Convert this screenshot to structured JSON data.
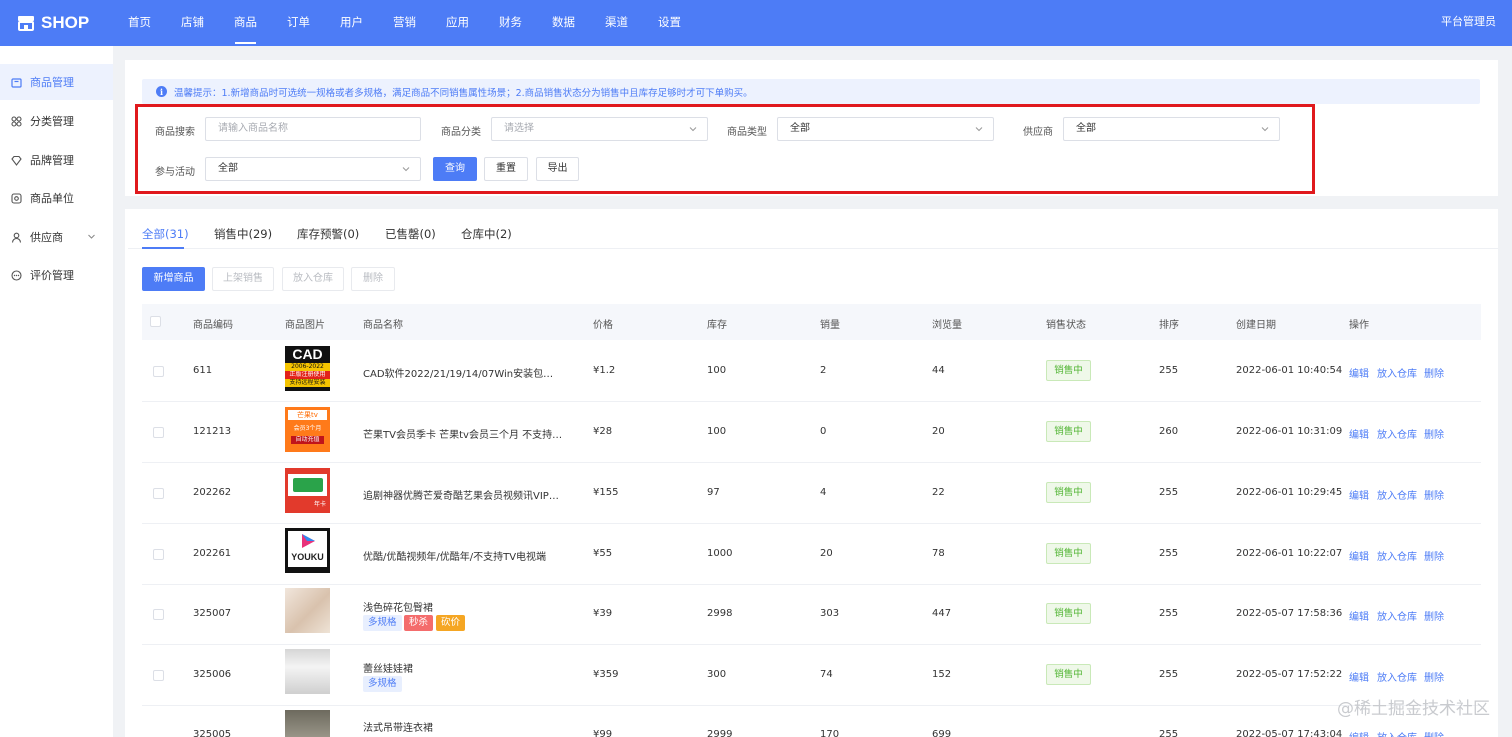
{
  "app": {
    "logo_text": "SHOP",
    "admin_label": "平台管理员"
  },
  "nav": [
    {
      "label": "首页"
    },
    {
      "label": "店铺"
    },
    {
      "label": "商品"
    },
    {
      "label": "订单"
    },
    {
      "label": "用户"
    },
    {
      "label": "营销"
    },
    {
      "label": "应用"
    },
    {
      "label": "财务"
    },
    {
      "label": "数据"
    },
    {
      "label": "渠道"
    },
    {
      "label": "设置"
    }
  ],
  "sidebar": [
    {
      "label": "商品管理",
      "icon": "bag-icon"
    },
    {
      "label": "分类管理",
      "icon": "grid-icon"
    },
    {
      "label": "品牌管理",
      "icon": "diamond-icon"
    },
    {
      "label": "商品单位",
      "icon": "unit-icon"
    },
    {
      "label": "供应商",
      "icon": "user-icon"
    },
    {
      "label": "评价管理",
      "icon": "comment-icon"
    }
  ],
  "tip": "温馨提示：1.新增商品时可选统一规格或者多规格，满足商品不同销售属性场景；2.商品销售状态分为销售中且库存足够时才可下单购买。",
  "filters": {
    "search_label": "商品搜索",
    "search_placeholder": "请输入商品名称",
    "category_label": "商品分类",
    "category_placeholder": "请选择",
    "type_label": "商品类型",
    "type_value": "全部",
    "supplier_label": "供应商",
    "supplier_value": "全部",
    "activity_label": "参与活动",
    "activity_value": "全部",
    "query_btn": "查询",
    "reset_btn": "重置",
    "export_btn": "导出"
  },
  "tabs": [
    "全部(31)",
    "销售中(29)",
    "库存预警(0)",
    "已售罄(0)",
    "仓库中(2)"
  ],
  "actions": {
    "add": "新增商品",
    "on_sale": "上架销售",
    "to_warehouse": "放入仓库",
    "delete": "删除"
  },
  "columns": [
    "商品编码",
    "商品图片",
    "商品名称",
    "价格",
    "库存",
    "销量",
    "浏览量",
    "销售状态",
    "排序",
    "创建日期",
    "操作"
  ],
  "row_ops": [
    "编辑",
    "放入仓库",
    "删除"
  ],
  "rows": [
    {
      "code": "611",
      "name": "CAD软件2022/21/19/14/07Win安装包下载制...",
      "price": "¥1.2",
      "stock": "100",
      "sales": "2",
      "views": "44",
      "status": "销售中",
      "sort": "255",
      "date": "2022-06-01 10:40:54",
      "thumb": "CAD",
      "thumb_lines": [
        "2006-2022",
        "正版注册使用",
        "支持远程安装"
      ]
    },
    {
      "code": "121213",
      "name": "芒果TV会员季卡 芒果tv会员三个月 不支持电...",
      "price": "¥28",
      "stock": "100",
      "sales": "0",
      "views": "20",
      "status": "销售中",
      "sort": "260",
      "date": "2022-06-01 10:31:09",
      "thumb": "芒果tv",
      "thumb_lines": [
        "会员3个月",
        "自动充值"
      ]
    },
    {
      "code": "202262",
      "name": "追剧神器优腾芒爱奇酷艺果会员视频讯VIP播...",
      "price": "¥155",
      "stock": "97",
      "sales": "4",
      "views": "22",
      "status": "销售中",
      "sort": "255",
      "date": "2022-06-01 10:29:45",
      "thumb": "",
      "thumb_lines": [
        "年卡"
      ]
    },
    {
      "code": "202261",
      "name": "优酷/优酷视频年/优酷年/不支持TV电视端",
      "price": "¥55",
      "stock": "1000",
      "sales": "20",
      "views": "78",
      "status": "销售中",
      "sort": "255",
      "date": "2022-06-01 10:22:07",
      "thumb": "YOUKU",
      "thumb_lines": []
    },
    {
      "code": "325007",
      "name": "浅色碎花包臀裙",
      "price": "¥39",
      "stock": "2998",
      "sales": "303",
      "views": "447",
      "status": "销售中",
      "sort": "255",
      "date": "2022-05-07 17:58:36",
      "tags": [
        "多规格",
        "秒杀",
        "砍价"
      ]
    },
    {
      "code": "325006",
      "name": "蕾丝娃娃裙",
      "price": "¥359",
      "stock": "300",
      "sales": "74",
      "views": "152",
      "status": "销售中",
      "sort": "255",
      "date": "2022-05-07 17:52:22",
      "tags": [
        "多规格"
      ]
    },
    {
      "code": "325005",
      "name": "法式吊带连衣裙",
      "price": "¥99",
      "stock": "2999",
      "sales": "170",
      "views": "699",
      "status": "销售中",
      "sort": "255",
      "date": "2022-05-07 17:43:04"
    }
  ],
  "watermark": "@稀土掘金技术社区",
  "colors": {
    "primary": "#4d7cf6",
    "highlight": "#e0191d",
    "success": "#52b534"
  }
}
